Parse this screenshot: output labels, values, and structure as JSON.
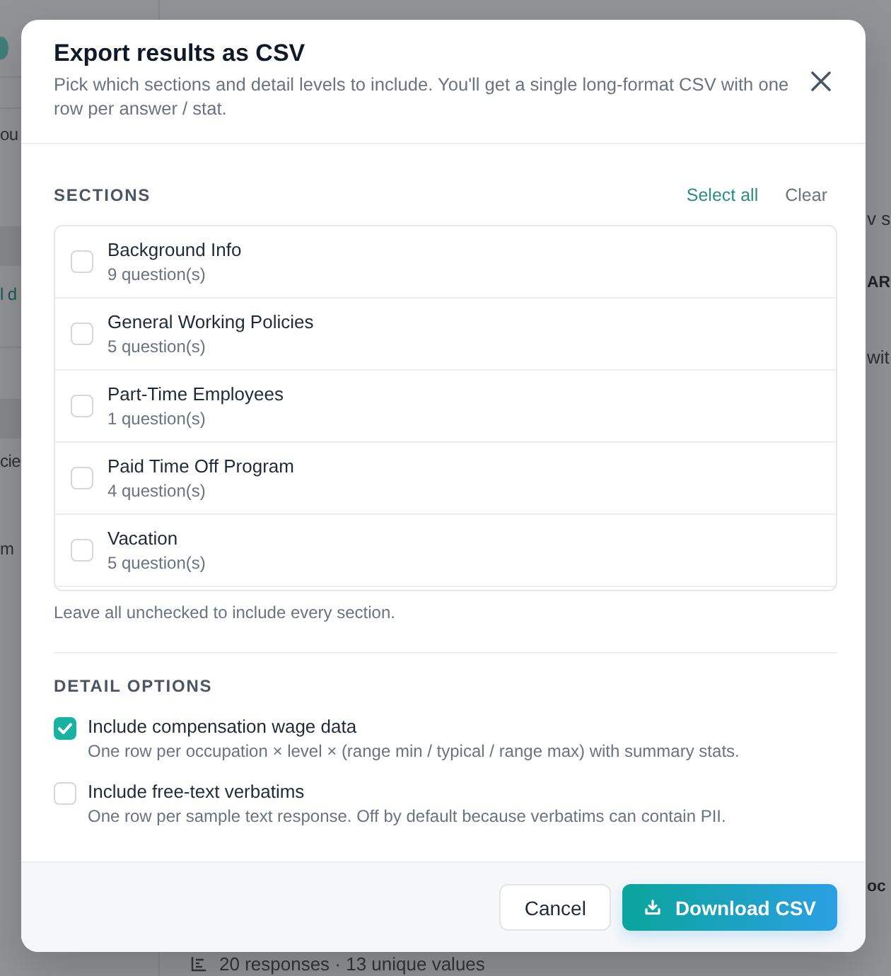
{
  "background_page": {
    "sidebar_items": [
      {
        "text": "ou",
        "kind": "text"
      },
      {
        "text": "l d",
        "kind": "link"
      },
      {
        "text": "cie",
        "kind": "text"
      },
      {
        "text": "m",
        "kind": "text"
      }
    ],
    "main_items": [
      {
        "text": "v s",
        "kind": "text"
      },
      {
        "text": "AR",
        "kind": "heading"
      },
      {
        "text": "wit",
        "kind": "text"
      },
      {
        "text": "oc",
        "kind": "heading"
      }
    ],
    "response_summary": "20 responses · 13 unique values"
  },
  "dialog": {
    "title": "Export results as CSV",
    "subtitle": "Pick which sections and detail levels to include. You'll get a single long-format CSV with one row per answer / stat.",
    "sections": {
      "heading": "SECTIONS",
      "select_all": "Select all",
      "clear": "Clear",
      "items": [
        {
          "name": "Background Info",
          "count": "9 question(s)",
          "checked": false
        },
        {
          "name": "General Working Policies",
          "count": "5 question(s)",
          "checked": false
        },
        {
          "name": "Part-Time Employees",
          "count": "1 question(s)",
          "checked": false
        },
        {
          "name": "Paid Time Off Program",
          "count": "4 question(s)",
          "checked": false
        },
        {
          "name": "Vacation",
          "count": "5 question(s)",
          "checked": false
        }
      ],
      "hint": "Leave all unchecked to include every section."
    },
    "detail_options": {
      "heading": "DETAIL OPTIONS",
      "items": [
        {
          "label": "Include compensation wage data",
          "description": "One row per occupation × level × (range min / typical / range max) with summary stats.",
          "checked": true
        },
        {
          "label": "Include free-text verbatims",
          "description": "One row per sample text response. Off by default because verbatims can contain PII.",
          "checked": false
        }
      ]
    },
    "buttons": {
      "cancel": "Cancel",
      "download": "Download CSV"
    }
  }
}
